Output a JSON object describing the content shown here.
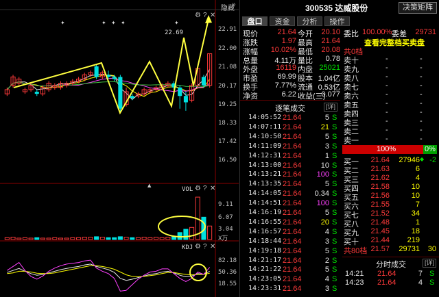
{
  "header": {
    "hide_label": "隐藏",
    "stock_code": "300535",
    "stock_name": "达威股份",
    "decision_button": "决策矩阵"
  },
  "tabs": [
    {
      "label": "盘口",
      "active": true
    },
    {
      "label": "资金",
      "active": false
    },
    {
      "label": "分析",
      "active": false
    },
    {
      "label": "操作",
      "active": false
    }
  ],
  "chart": {
    "price_axis": [
      "22.91",
      "22.00",
      "21.08",
      "20.17",
      "19.25",
      "18.33",
      "17.42",
      "16.50"
    ],
    "vol_axis": [
      "9.11",
      "6.07",
      "3.04",
      "X万"
    ],
    "vol_label": "VOL",
    "kdj_label": "KDJ",
    "kdj_axis": [
      "82.18",
      "50.36",
      "18.55"
    ],
    "price_annotation": "22.69",
    "candles": [
      {
        "o": 19.7,
        "c": 19.9,
        "h": 20.0,
        "l": 19.6
      },
      {
        "o": 20.1,
        "c": 20.5,
        "h": 20.6,
        "l": 20.0
      },
      {
        "o": 20.2,
        "c": 20.4,
        "h": 20.5,
        "l": 20.1
      },
      {
        "o": 19.8,
        "c": 19.9,
        "h": 20.0,
        "l": 19.7
      },
      {
        "o": 19.9,
        "c": 20.1,
        "h": 20.2,
        "l": 19.8
      },
      {
        "o": 19.8,
        "c": 19.7,
        "h": 19.9,
        "l": 19.6
      },
      {
        "o": 19.7,
        "c": 20.0,
        "h": 20.1,
        "l": 19.6
      },
      {
        "o": 19.9,
        "c": 20.2,
        "h": 20.3,
        "l": 19.8
      },
      {
        "o": 20.0,
        "c": 20.1,
        "h": 20.2,
        "l": 19.9
      },
      {
        "o": 20.0,
        "c": 20.2,
        "h": 20.3,
        "l": 19.9
      },
      {
        "o": 20.1,
        "c": 20.2,
        "h": 20.3,
        "l": 20.0
      },
      {
        "o": 20.2,
        "c": 20.3,
        "h": 20.4,
        "l": 20.1
      },
      {
        "o": 20.3,
        "c": 20.4,
        "h": 20.5,
        "l": 20.2
      },
      {
        "o": 20.4,
        "c": 20.6,
        "h": 20.7,
        "l": 20.3
      },
      {
        "o": 20.6,
        "c": 20.7,
        "h": 20.8,
        "l": 20.5
      },
      {
        "o": 21.0,
        "c": 20.5,
        "h": 21.1,
        "l": 20.4
      },
      {
        "o": 20.5,
        "c": 20.7,
        "h": 20.8,
        "l": 20.4
      },
      {
        "o": 20.6,
        "c": 20.5,
        "h": 20.8,
        "l": 20.4
      },
      {
        "o": 20.5,
        "c": 20.4,
        "h": 20.6,
        "l": 20.3
      },
      {
        "o": 20.5,
        "c": 19.0,
        "h": 20.6,
        "l": 18.8
      },
      {
        "o": 19.2,
        "c": 19.8,
        "h": 20.0,
        "l": 19.1
      },
      {
        "o": 19.6,
        "c": 19.5,
        "h": 19.7,
        "l": 19.4
      },
      {
        "o": 19.6,
        "c": 19.7,
        "h": 19.8,
        "l": 19.5
      },
      {
        "o": 19.7,
        "c": 19.9,
        "h": 20.0,
        "l": 19.6
      },
      {
        "o": 19.8,
        "c": 19.9,
        "h": 20.0,
        "l": 19.7
      },
      {
        "o": 19.9,
        "c": 20.0,
        "h": 20.1,
        "l": 19.8
      },
      {
        "o": 20.0,
        "c": 20.1,
        "h": 20.2,
        "l": 19.9
      },
      {
        "o": 20.1,
        "c": 20.2,
        "h": 20.3,
        "l": 20.0
      },
      {
        "o": 20.2,
        "c": 20.0,
        "h": 20.3,
        "l": 19.9
      },
      {
        "o": 20.0,
        "c": 19.6,
        "h": 20.1,
        "l": 19.0
      },
      {
        "o": 19.6,
        "c": 19.3,
        "h": 19.8,
        "l": 18.9
      },
      {
        "o": 19.4,
        "c": 20.1,
        "h": 20.2,
        "l": 19.3
      },
      {
        "o": 20.1,
        "c": 20.9,
        "h": 21.0,
        "l": 20.0
      },
      {
        "o": 20.5,
        "c": 20.1,
        "h": 20.6,
        "l": 20.0
      },
      {
        "o": 20.1,
        "c": 21.6,
        "h": 21.6,
        "l": 20.0
      }
    ],
    "volumes": [
      0.4,
      0.5,
      0.3,
      0.4,
      0.3,
      0.4,
      0.3,
      0.3,
      0.4,
      0.3,
      0.3,
      0.4,
      0.4,
      0.5,
      0.5,
      0.6,
      0.5,
      0.4,
      0.4,
      0.6,
      0.5,
      0.4,
      0.4,
      0.5,
      0.4,
      0.5,
      0.4,
      0.5,
      0.6,
      1.5,
      2.2,
      2.6,
      9.1,
      4.8,
      2.9
    ],
    "kdj_k": [
      55,
      60,
      65,
      58,
      52,
      48,
      50,
      54,
      58,
      62,
      65,
      68,
      70,
      74,
      76,
      70,
      66,
      62,
      55,
      40,
      35,
      38,
      42,
      46,
      50,
      52,
      56,
      58,
      54,
      48,
      44,
      46,
      52,
      50,
      58
    ],
    "kdj_d": [
      52,
      54,
      58,
      58,
      56,
      53,
      52,
      52,
      54,
      57,
      60,
      63,
      66,
      69,
      72,
      72,
      70,
      67,
      63,
      56,
      49,
      45,
      44,
      45,
      47,
      49,
      52,
      55,
      55,
      52,
      50,
      49,
      50,
      50,
      53
    ],
    "kdj_j": [
      60,
      70,
      80,
      60,
      45,
      38,
      46,
      58,
      66,
      72,
      76,
      78,
      80,
      84,
      86,
      66,
      58,
      52,
      40,
      8,
      10,
      24,
      38,
      48,
      56,
      58,
      64,
      64,
      52,
      40,
      32,
      40,
      56,
      50,
      68
    ]
  },
  "quote": {
    "rows": [
      {
        "l1": "现价",
        "v1": "21.64",
        "c1": "red",
        "l2": "今开",
        "v2": "20.10",
        "c2": "red",
        "l3": "委比",
        "v3": "100.00%",
        "c3": "red",
        "l4": "委差",
        "v4": "29731",
        "c4": "red"
      },
      {
        "l1": "涨跌",
        "v1": "1.97",
        "c1": "red",
        "l2": "最高",
        "v2": "21.64",
        "c2": "red"
      },
      {
        "l1": "涨幅",
        "v1": "10.02%",
        "c1": "red",
        "l2": "最低",
        "v2": "20.08",
        "c2": "red"
      },
      {
        "l1": "总量",
        "v1": "4.11万",
        "c1": "white",
        "l2": "量比",
        "v2": "0.78",
        "c2": "white"
      },
      {
        "l1": "外盘",
        "v1": "16119",
        "c1": "red",
        "l2": "内盘",
        "v2": "25021",
        "c2": "green"
      },
      {
        "l1": "市盈",
        "v1": "69.99",
        "c1": "white",
        "l2": "股本",
        "v2": "1.04亿",
        "c2": "white"
      },
      {
        "l1": "换手",
        "v1": "7.77%",
        "c1": "white",
        "l2": "流通",
        "v2": "0.53亿",
        "c2": "white"
      },
      {
        "l1": "净资",
        "v1": "6.22",
        "c1": "white",
        "l2": "收益(三)",
        "v2": "0.077",
        "c2": "white"
      }
    ],
    "orderbook_link": "查看完整档买卖盘"
  },
  "sell_side": {
    "title": "共0档",
    "levels": [
      "卖十",
      "卖九",
      "卖八",
      "卖七",
      "卖六",
      "卖五",
      "卖四",
      "卖三",
      "卖二",
      "卖一"
    ],
    "dash": "-"
  },
  "ratio_bar": {
    "left": "100%",
    "right": "0%"
  },
  "buy_side": {
    "levels": [
      {
        "name": "买一",
        "price": "21.64",
        "vol": "27946",
        "extra": "-2"
      },
      {
        "name": "买二",
        "price": "21.63",
        "vol": "6",
        "extra": ""
      },
      {
        "name": "买三",
        "price": "21.62",
        "vol": "4",
        "extra": ""
      },
      {
        "name": "买四",
        "price": "21.58",
        "vol": "10",
        "extra": ""
      },
      {
        "name": "买五",
        "price": "21.56",
        "vol": "10",
        "extra": ""
      },
      {
        "name": "买六",
        "price": "21.55",
        "vol": "7",
        "extra": ""
      },
      {
        "name": "买七",
        "price": "21.52",
        "vol": "34",
        "extra": ""
      },
      {
        "name": "买八",
        "price": "21.48",
        "vol": "1",
        "extra": ""
      },
      {
        "name": "买九",
        "price": "21.45",
        "vol": "18",
        "extra": ""
      },
      {
        "name": "买十",
        "price": "21.44",
        "vol": "219",
        "extra": ""
      }
    ],
    "total": {
      "name": "共80档",
      "price": "21.57",
      "vol": "29731",
      "extra": "30"
    }
  },
  "trades": {
    "title": "逐笔成交",
    "detail_label": "[详]",
    "rows": [
      {
        "t": "14:05:52",
        "p": "21.64",
        "v": "5",
        "s": "S",
        "vc": "white"
      },
      {
        "t": "14:07:11",
        "p": "21.64",
        "v": "21",
        "s": "S",
        "vc": "yellow"
      },
      {
        "t": "14:10:50",
        "p": "21.64",
        "v": "5",
        "s": "S",
        "vc": "white"
      },
      {
        "t": "14:11:09",
        "p": "21.64",
        "v": "3",
        "s": "S",
        "vc": "white"
      },
      {
        "t": "14:12:31",
        "p": "21.64",
        "v": "1",
        "s": "S",
        "vc": "white"
      },
      {
        "t": "14:13:00",
        "p": "21.64",
        "v": "10",
        "s": "S",
        "vc": "white"
      },
      {
        "t": "14:13:21",
        "p": "21.64",
        "v": "100",
        "s": "S",
        "vc": "magenta"
      },
      {
        "t": "14:13:35",
        "p": "21.64",
        "v": "5",
        "s": "S",
        "vc": "white"
      },
      {
        "t": "14:14:05",
        "p": "21.64",
        "v": "0.34",
        "s": "S",
        "vc": "white"
      },
      {
        "t": "14:14:51",
        "p": "21.64",
        "v": "100",
        "s": "S",
        "vc": "magenta"
      },
      {
        "t": "14:16:19",
        "p": "21.64",
        "v": "5",
        "s": "S",
        "vc": "white"
      },
      {
        "t": "14:16:55",
        "p": "21.64",
        "v": "20",
        "s": "S",
        "vc": "yellow"
      },
      {
        "t": "14:16:57",
        "p": "21.64",
        "v": "4",
        "s": "S",
        "vc": "white"
      },
      {
        "t": "14:18:44",
        "p": "21.64",
        "v": "3",
        "s": "S",
        "vc": "white"
      },
      {
        "t": "14:19:18",
        "p": "21.64",
        "v": "5",
        "s": "S",
        "vc": "white"
      },
      {
        "t": "14:21:17",
        "p": "21.64",
        "v": "2",
        "s": "S",
        "vc": "white"
      },
      {
        "t": "14:21:22",
        "p": "21.64",
        "v": "5",
        "s": "S",
        "vc": "white"
      },
      {
        "t": "14:23:05",
        "p": "21.64",
        "v": "4",
        "s": "S",
        "vc": "white"
      },
      {
        "t": "14:23:31",
        "p": "21.64",
        "v": "3",
        "s": "S",
        "vc": "white"
      }
    ]
  },
  "minute_trades": {
    "title": "分时成交",
    "detail_label": "[详]",
    "rows": [
      {
        "t": "14:21",
        "p": "21.64",
        "v": "7",
        "s": "S"
      },
      {
        "t": "14:23",
        "p": "21.64",
        "v": "4",
        "s": "S"
      }
    ]
  },
  "colors": {
    "up": "#ff3a3a",
    "down": "#00e0e0",
    "ma_white": "#e8e8e8",
    "ma_yellow": "#ffff00",
    "ma_magenta": "#ff40ff",
    "ma_green": "#40c040",
    "annot": "#ffff40"
  }
}
